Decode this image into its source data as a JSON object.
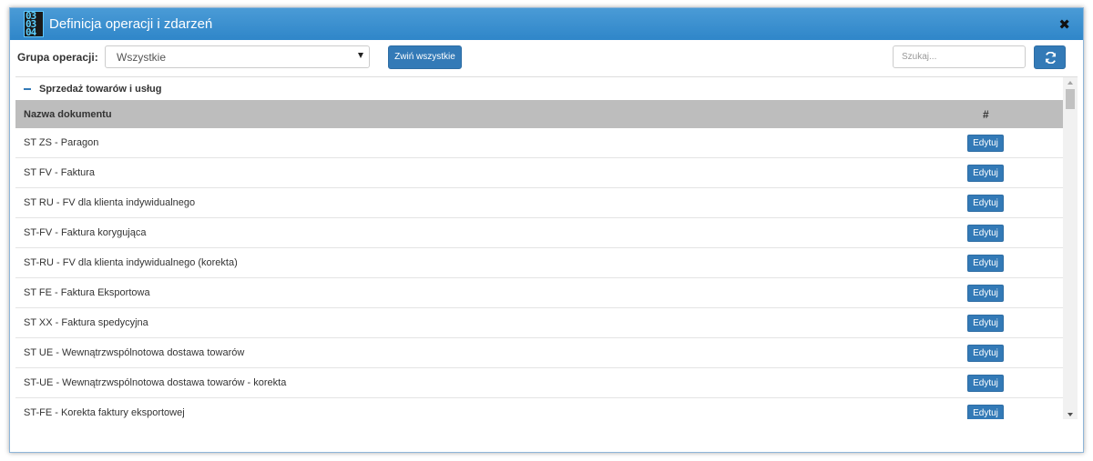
{
  "window": {
    "title": "Definicja operacji i zdarzeń",
    "app_icon": "digital-clock-icon",
    "app_icon_digits": [
      "03",
      "03",
      "04"
    ],
    "close_symbol": "✖"
  },
  "toolbar": {
    "group_label": "Grupa operacji:",
    "group_select_value": "Wszystkie",
    "collapse_all_label": "Zwiń wszystkie",
    "search_placeholder": "Szukaj...",
    "refresh_icon": "refresh-icon"
  },
  "group": {
    "title": "Sprzedaż towarów i usług",
    "toggle_symbol": "minus"
  },
  "table": {
    "headers": {
      "name": "Nazwa dokumentu",
      "action": "#"
    },
    "edit_label": "Edytuj",
    "rows": [
      "ST ZS - Paragon",
      "ST FV - Faktura",
      "ST RU - FV dla klienta indywidualnego",
      "ST-FV - Faktura korygująca",
      "ST-RU - FV dla klienta indywidualnego (korekta)",
      "ST FE - Faktura Eksportowa",
      "ST XX - Faktura spedycyjna",
      "ST UE - Wewnątrzwspólnotowa dostawa towarów",
      "ST-UE - Wewnątrzwspólnotowa dostawa towarów - korekta",
      "ST-FE - Korekta faktury eksportowej"
    ]
  },
  "colors": {
    "titlebar": "#3a8fcf",
    "primary_button": "#337ab7",
    "table_header": "#bdbdbd"
  }
}
